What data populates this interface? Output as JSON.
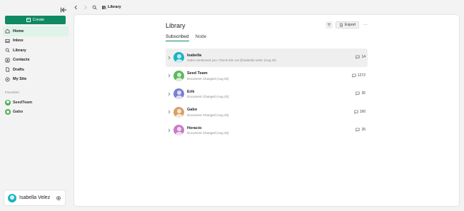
{
  "sidebar": {
    "create_label": "Create",
    "nav": [
      {
        "label": "Home",
        "icon": "home-icon",
        "active": true
      },
      {
        "label": "Inbox",
        "icon": "inbox-icon"
      },
      {
        "label": "Library",
        "icon": "search-icon"
      },
      {
        "label": "Contacts",
        "icon": "contacts-icon"
      },
      {
        "label": "Drafts",
        "icon": "drafts-icon"
      },
      {
        "label": "My Site",
        "icon": "site-icon"
      }
    ],
    "favorites_title": "Favorites",
    "favorites": [
      {
        "label": "SeedTeam"
      },
      {
        "label": "Gabo"
      }
    ],
    "user_name": "Isabella Velez"
  },
  "topbar": {
    "breadcrumb": "Library"
  },
  "main": {
    "title": "Library",
    "export_label": "Export",
    "more_label": "···",
    "tabs": [
      {
        "label": "Subscribed",
        "active": true
      },
      {
        "label": "Node"
      }
    ],
    "rows": [
      {
        "name": "Isabella",
        "sub": "Gabo mentioned you: Check this out @Isabella Velez  (Aug 20)",
        "count": "14",
        "color": "#1ab3c4",
        "highlight": true
      },
      {
        "name": "Seed Team",
        "sub": "Document Changed  (Aug 20)",
        "count": "1272",
        "color": "#5cb85c"
      },
      {
        "name": "Erik",
        "sub": "Document Changed  (Aug 20)",
        "count": "35",
        "color": "#7b7fd4"
      },
      {
        "name": "Gabo",
        "sub": "Document Changed  (Aug 20)",
        "count": "190",
        "color": "#d9a066"
      },
      {
        "name": "Horacio",
        "sub": "Document Changed  (Aug 20)",
        "count": "26",
        "color": "#c77dc7"
      }
    ]
  },
  "colors": {
    "accent": "#0f8a63",
    "active_bg": "#dff3e9"
  }
}
